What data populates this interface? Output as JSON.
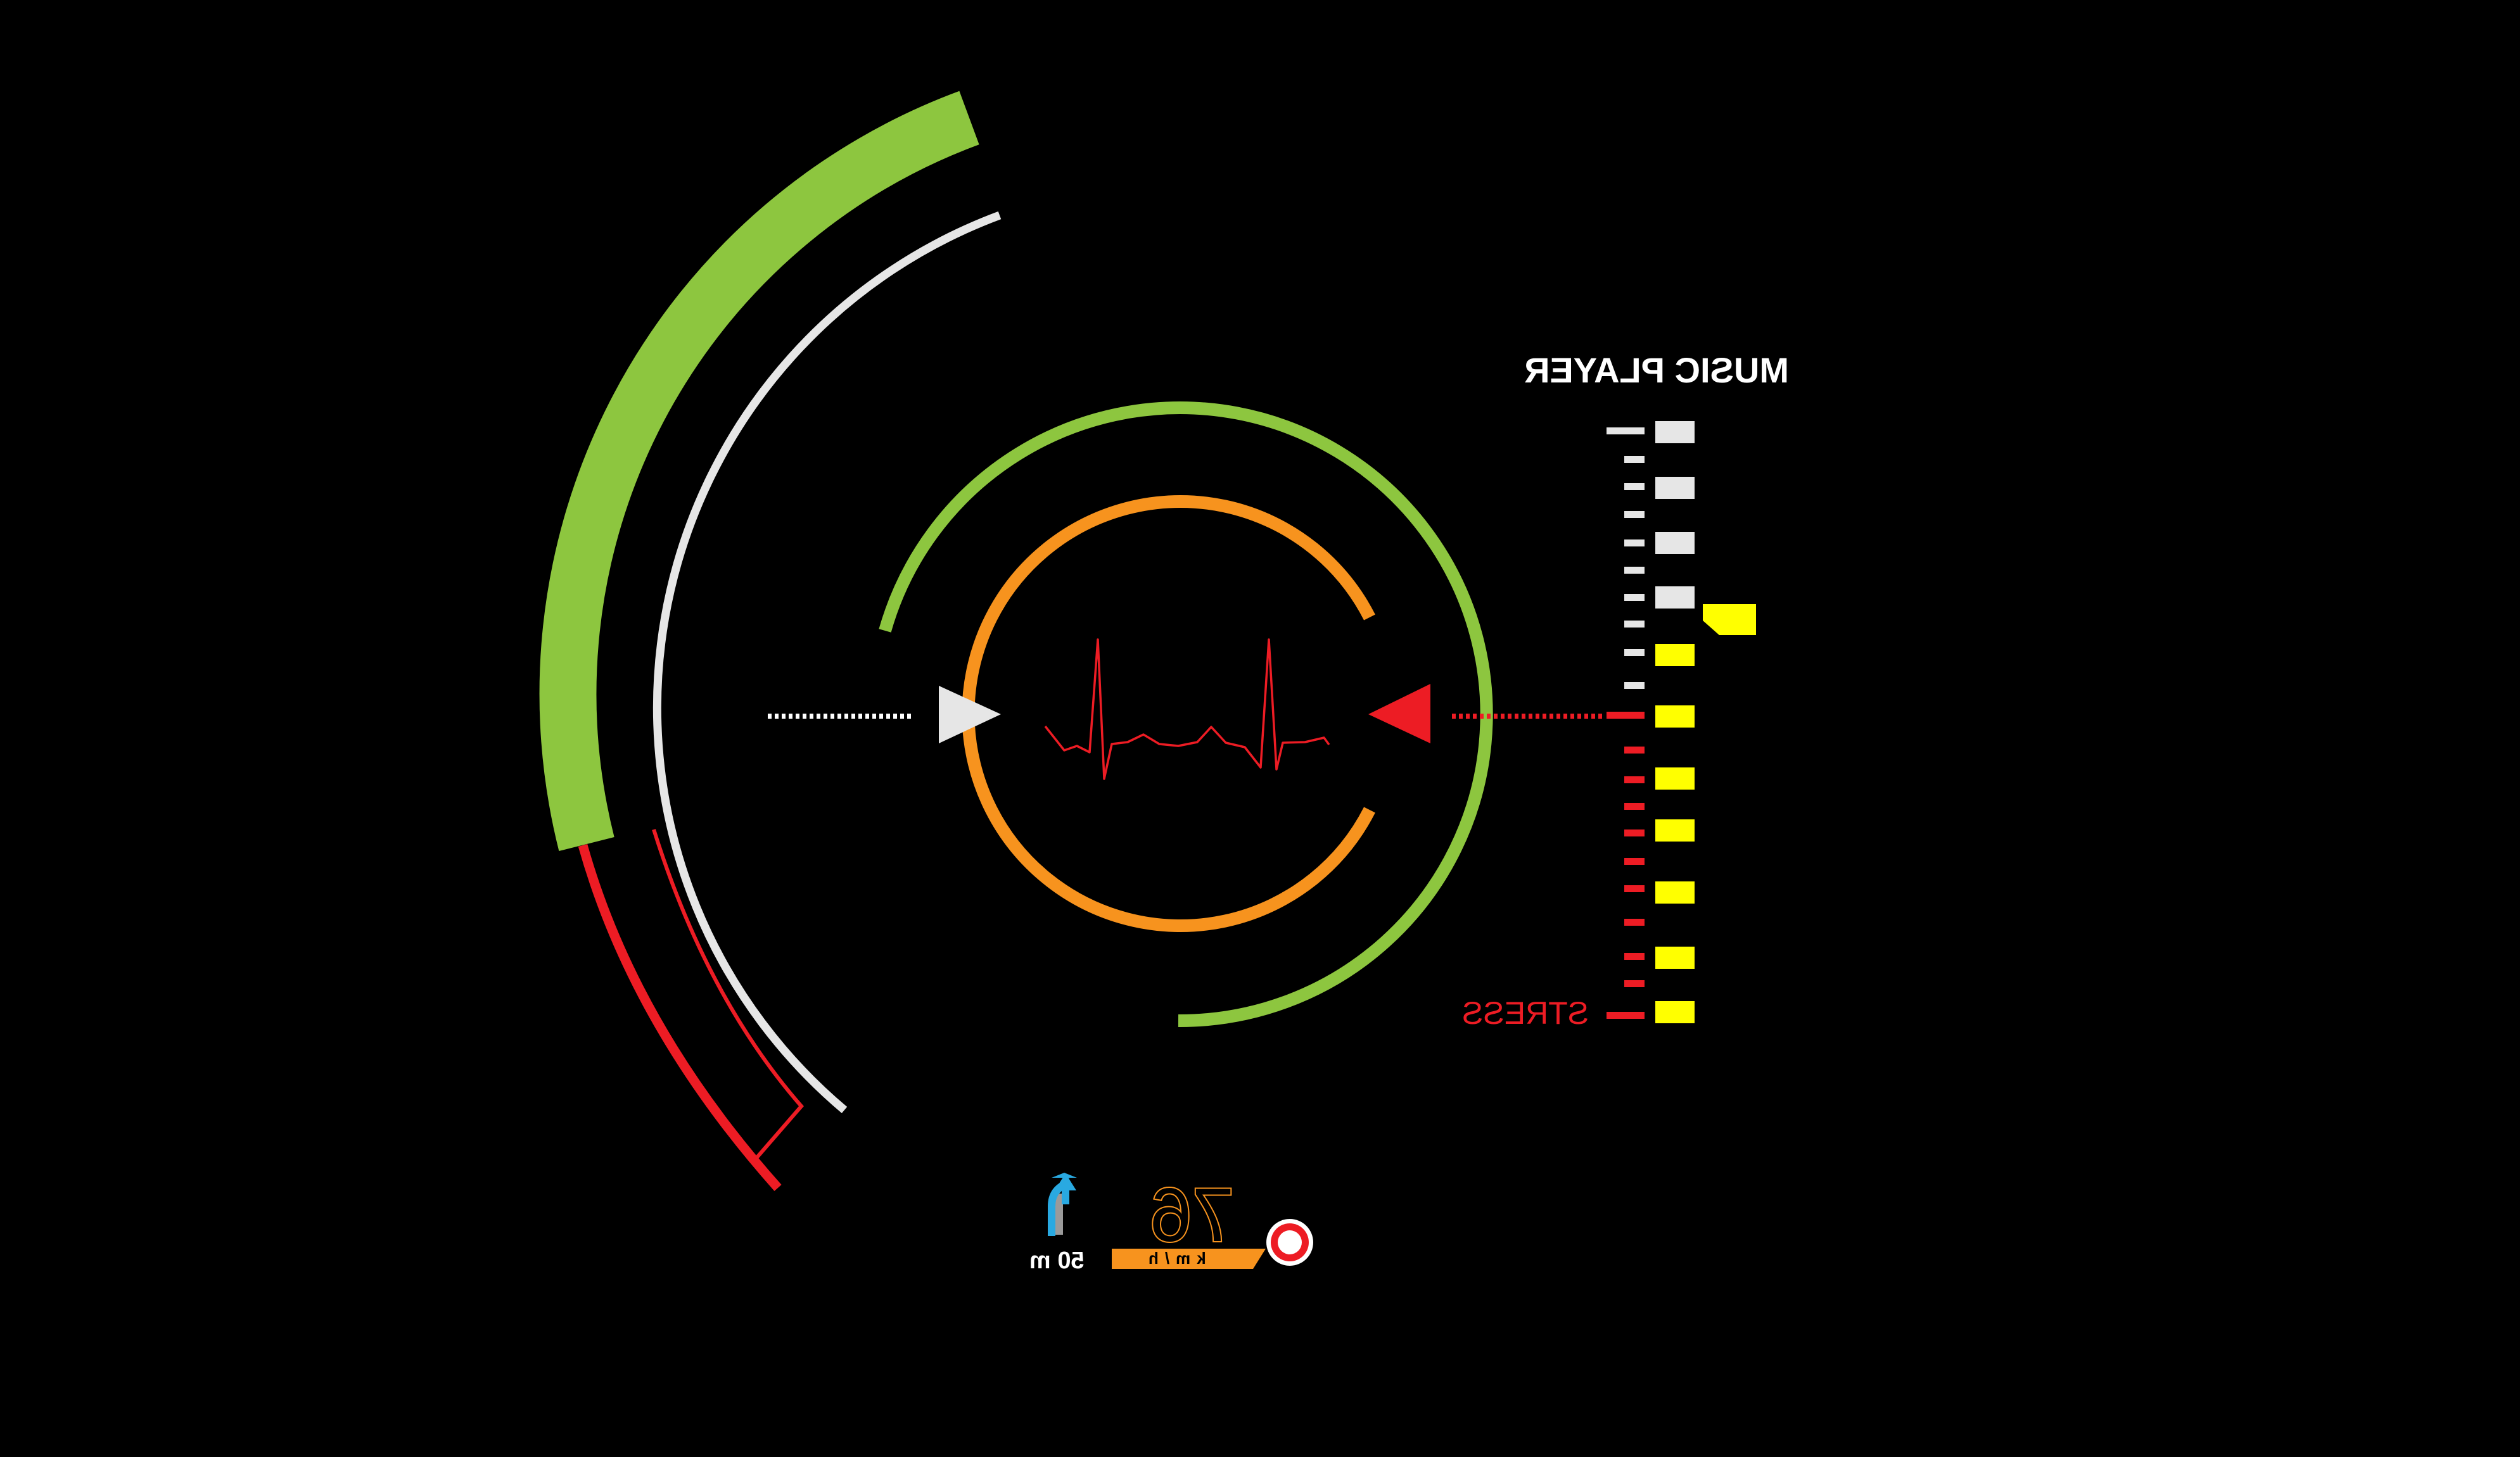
{
  "music_player": {
    "label": "MUSIC PLAYER",
    "level_fraction": 0.65
  },
  "stress": {
    "label": "STRESS"
  },
  "speed": {
    "value": "76",
    "unit": "km/h"
  },
  "navigation": {
    "distance": "50 m",
    "direction_icon": "turn-up-arrow-icon"
  },
  "icons": {
    "speed_limit": "speed-limit-sign-icon",
    "heartbeat": "heartbeat-icon",
    "left_pointer": "triangle-right-icon",
    "right_pointer": "triangle-left-icon",
    "level_marker": "pentagon-marker-icon"
  },
  "colors": {
    "green": "#8dc63f",
    "orange": "#f7931e",
    "red": "#ed1c24",
    "white": "#e6e6e6",
    "yellow": "#ffff00",
    "blue": "#29a9e1",
    "background": "#000000"
  }
}
